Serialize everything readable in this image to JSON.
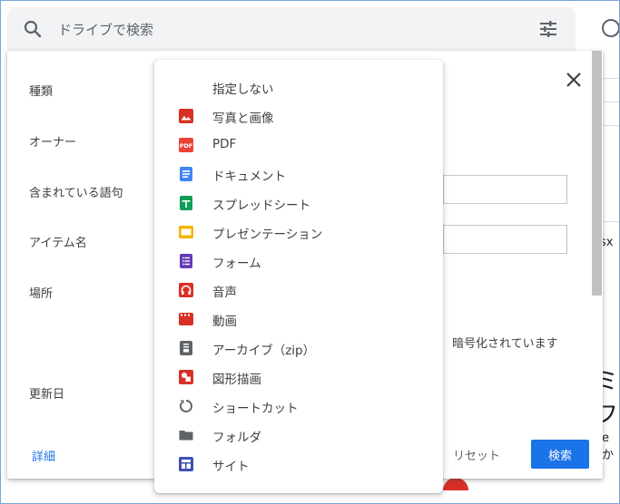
{
  "search": {
    "placeholder": "ドライブで検索",
    "search_icon": "search-icon",
    "options_icon": "tune-icon"
  },
  "dialog": {
    "labels": {
      "type": "種類",
      "owner": "オーナー",
      "contains_words": "含まれている語句",
      "item_name": "アイテム名",
      "location": "場所",
      "modified_date": "更新日"
    },
    "encrypted_text": "暗号化されています",
    "detail_link": "詳細",
    "reset_button": "リセット",
    "search_button": "検索",
    "close_icon": "close-icon"
  },
  "type_menu": {
    "items": [
      {
        "label": "指定しない",
        "icon": "none",
        "color": ""
      },
      {
        "label": "写真と画像",
        "icon": "image-icon",
        "color": "#d93025"
      },
      {
        "label": "PDF",
        "icon": "pdf-icon",
        "color": "#ea4335"
      },
      {
        "label": "ドキュメント",
        "icon": "docs-icon",
        "color": "#4285f4"
      },
      {
        "label": "スプレッドシート",
        "icon": "sheets-icon",
        "color": "#0f9d58"
      },
      {
        "label": "プレゼンテーション",
        "icon": "slides-icon",
        "color": "#f4b400"
      },
      {
        "label": "フォーム",
        "icon": "forms-icon",
        "color": "#673ab7"
      },
      {
        "label": "音声",
        "icon": "audio-icon",
        "color": "#d93025"
      },
      {
        "label": "動画",
        "icon": "video-icon",
        "color": "#d93025"
      },
      {
        "label": "アーカイブ（zip）",
        "icon": "archive-icon",
        "color": "#5f6368"
      },
      {
        "label": "図形描画",
        "icon": "drawing-icon",
        "color": "#d93025"
      },
      {
        "label": "ショートカット",
        "icon": "shortcut-icon",
        "color": "#5f6368"
      },
      {
        "label": "フォルダ",
        "icon": "folder-icon",
        "color": "#5f6368"
      },
      {
        "label": "サイト",
        "icon": "sites-icon",
        "color": "#3f51b5"
      }
    ]
  },
  "background": {
    "partial_text_1": "sx",
    "partial_text_2": "ミフ",
    "partial_text_3": "e か"
  }
}
